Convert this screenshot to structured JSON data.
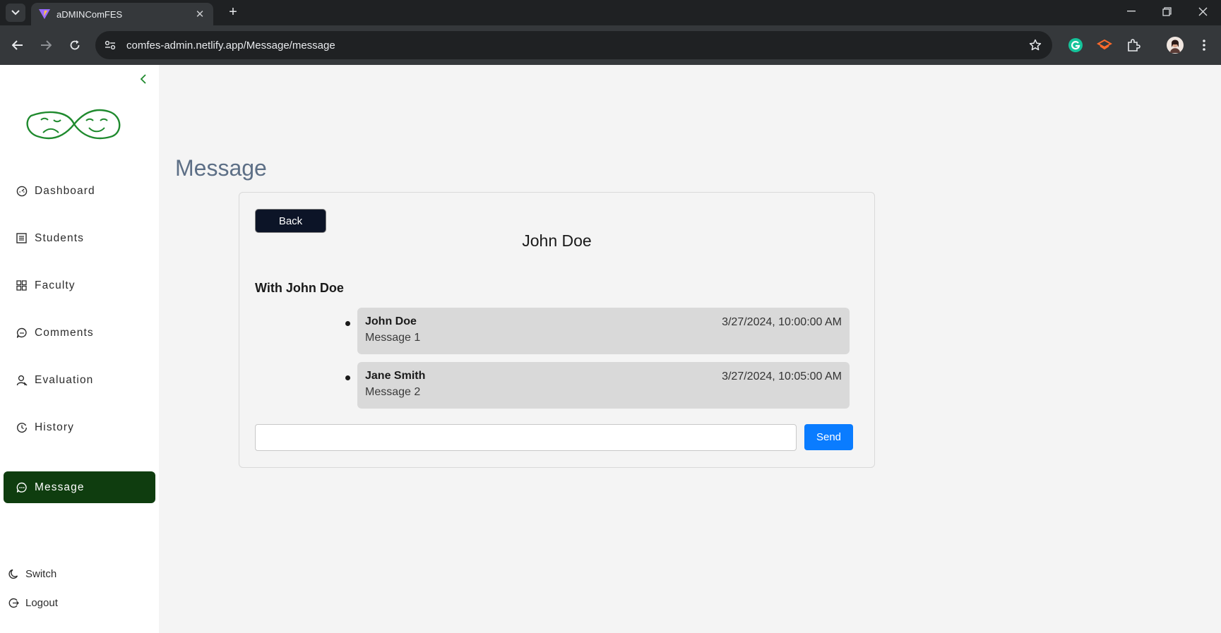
{
  "browser": {
    "tab_title": "aDMINComFES",
    "url": "comfes-admin.netlify.app/Message/message"
  },
  "sidebar": {
    "items": [
      {
        "label": "Dashboard",
        "icon": "dashboard-icon"
      },
      {
        "label": "Students",
        "icon": "students-icon"
      },
      {
        "label": "Faculty",
        "icon": "faculty-icon"
      },
      {
        "label": "Comments",
        "icon": "comments-icon"
      },
      {
        "label": "Evaluation",
        "icon": "evaluation-icon"
      },
      {
        "label": "History",
        "icon": "history-icon"
      },
      {
        "label": "Message",
        "icon": "message-icon",
        "active": true
      }
    ],
    "switch_label": "Switch",
    "logout_label": "Logout",
    "accent_color": "#0f3d0f"
  },
  "main": {
    "page_title": "Message",
    "back_label": "Back",
    "chat_title": "John Doe",
    "with_label": "With John Doe",
    "messages": [
      {
        "sender": "John Doe",
        "time": "3/27/2024, 10:00:00 AM",
        "text": "Message 1"
      },
      {
        "sender": "Jane Smith",
        "time": "3/27/2024, 10:05:00 AM",
        "text": "Message 2"
      }
    ],
    "input_value": "",
    "send_label": "Send",
    "send_color": "#0a7cff"
  }
}
